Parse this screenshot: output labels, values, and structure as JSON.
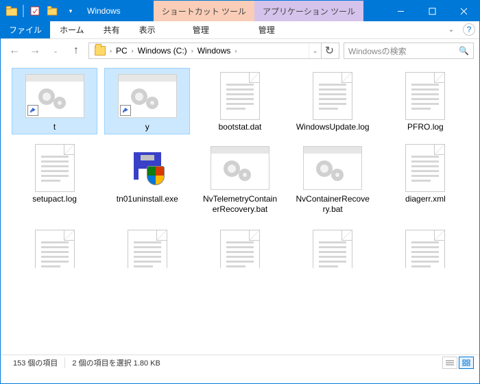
{
  "titlebar": {
    "title": "Windows"
  },
  "tool_tabs": {
    "shortcut": "ショートカット ツール",
    "app": "アプリケーション ツール"
  },
  "ribbon": {
    "file": "ファイル",
    "home": "ホーム",
    "share": "共有",
    "view": "表示",
    "manage1": "管理",
    "manage2": "管理"
  },
  "breadcrumb": {
    "pc": "PC",
    "drive": "Windows (C:)",
    "folder": "Windows"
  },
  "search": {
    "placeholder": "Windowsの検索"
  },
  "items": [
    {
      "name": "t",
      "icon": "bat-shortcut",
      "selected": true
    },
    {
      "name": "y",
      "icon": "bat-shortcut",
      "selected": true
    },
    {
      "name": "bootstat.dat",
      "icon": "doc"
    },
    {
      "name": "WindowsUpdate.log",
      "icon": "doc"
    },
    {
      "name": "PFRO.log",
      "icon": "doc"
    },
    {
      "name": "setupact.log",
      "icon": "doc"
    },
    {
      "name": "tn01uninstall.exe",
      "icon": "exe"
    },
    {
      "name": "NvTelemetryContainerRecovery.bat",
      "icon": "bat"
    },
    {
      "name": "NvContainerRecovery.bat",
      "icon": "bat"
    },
    {
      "name": "diagerr.xml",
      "icon": "doc"
    },
    {
      "name": "",
      "icon": "doc",
      "partial": true
    },
    {
      "name": "",
      "icon": "doc",
      "partial": true
    },
    {
      "name": "",
      "icon": "doc",
      "partial": true
    },
    {
      "name": "",
      "icon": "doc",
      "partial": true
    },
    {
      "name": "",
      "icon": "doc",
      "partial": true
    }
  ],
  "status": {
    "count": "153 個の項目",
    "selected": "2 個の項目を選択  1.80 KB"
  }
}
